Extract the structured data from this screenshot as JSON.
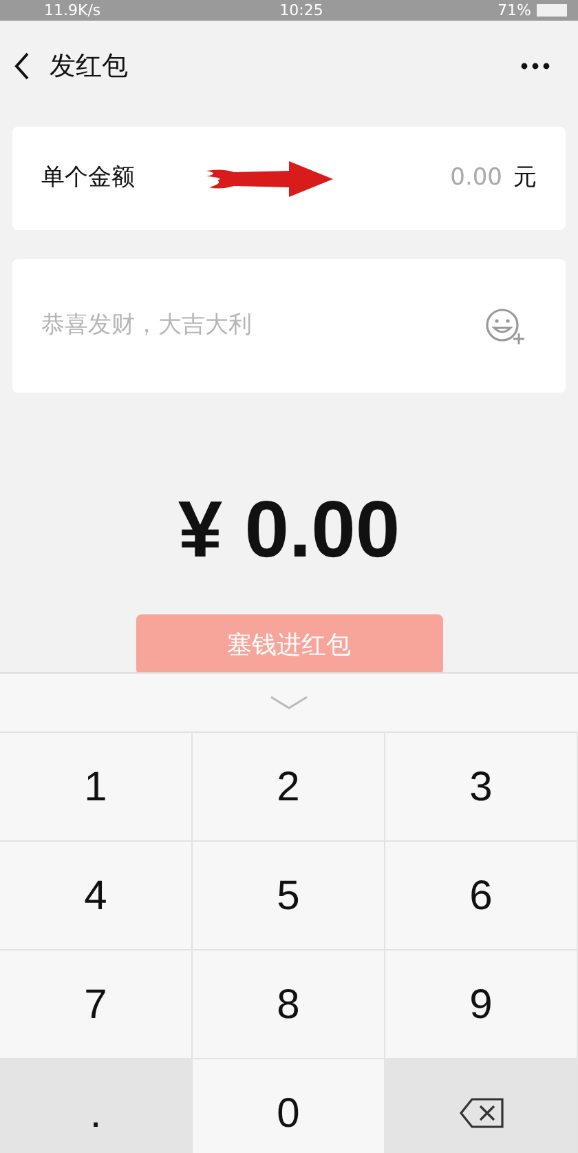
{
  "status_bar": {
    "speed": "11.9K/s",
    "time": "10:25",
    "battery": "71%"
  },
  "header": {
    "title": "发红包"
  },
  "amount_row": {
    "label": "单个金额",
    "placeholder": "0.00",
    "unit": "元"
  },
  "greeting": {
    "placeholder": "恭喜发财，大吉大利"
  },
  "total": {
    "currency": "¥",
    "value": "0.00"
  },
  "submit": {
    "label": "塞钱进红包",
    "disabled": true
  },
  "keypad": {
    "keys": [
      {
        "kind": "digit",
        "label": "1"
      },
      {
        "kind": "digit",
        "label": "2"
      },
      {
        "kind": "digit",
        "label": "3"
      },
      {
        "kind": "digit",
        "label": "4"
      },
      {
        "kind": "digit",
        "label": "5"
      },
      {
        "kind": "digit",
        "label": "6"
      },
      {
        "kind": "digit",
        "label": "7"
      },
      {
        "kind": "digit",
        "label": "8"
      },
      {
        "kind": "digit",
        "label": "9"
      },
      {
        "kind": "dot",
        "label": "."
      },
      {
        "kind": "digit",
        "label": "0"
      },
      {
        "kind": "backspace"
      }
    ]
  }
}
